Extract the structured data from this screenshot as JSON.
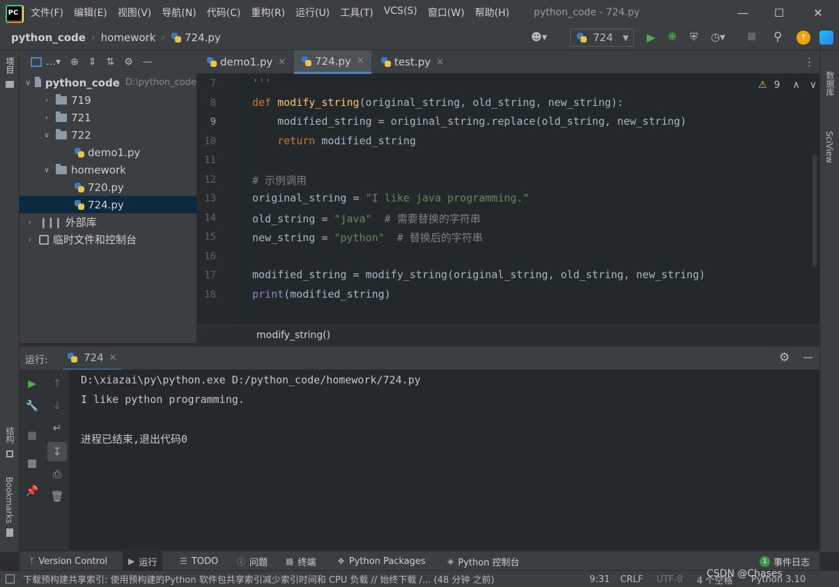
{
  "app": {
    "menu": [
      "文件(F)",
      "编辑(E)",
      "视图(V)",
      "导航(N)",
      "代码(C)",
      "重构(R)",
      "运行(U)",
      "工具(T)",
      "VCS(S)",
      "窗口(W)",
      "帮助(H)"
    ],
    "window_title": "python_code - 724.py"
  },
  "nav": {
    "crumbs": [
      "python_code",
      "homework",
      "724.py"
    ],
    "run_config": "724"
  },
  "left_strip": {
    "project": "项目",
    "structure": "结构",
    "bookmarks": "Bookmarks"
  },
  "right_strip": {
    "database": "数据库",
    "sciview": "SciView"
  },
  "project": {
    "root": "python_code",
    "root_path": "D:\\python_code",
    "items": [
      "719",
      "721",
      "722",
      "demo1.py",
      "homework",
      "720.py",
      "724.py",
      "外部库",
      "临时文件和控制台"
    ]
  },
  "tabs": [
    "demo1.py",
    "724.py",
    "test.py"
  ],
  "editor": {
    "line_numbers": [
      "7",
      "8",
      "9",
      "10",
      "11",
      "12",
      "13",
      "14",
      "15",
      "16",
      "17",
      "18"
    ],
    "warnings": "9",
    "breadcrumb": "modify_string()",
    "line7": "'''",
    "line8": {
      "kw": "def ",
      "fn": "modify_string",
      "args": "(original_string, old_string, new_string):"
    },
    "line9": "    modified_string = original_string.replace(old_string, new_string)",
    "line10": {
      "kw": "    return ",
      "rest": "modified_string"
    },
    "line12": "# 示例调用",
    "line13": {
      "var": "original_string = ",
      "str": "\"I like java programming.\""
    },
    "line14": {
      "var": "old_string = ",
      "str": "\"java\"",
      "cm": "  # 需要替换的字符串"
    },
    "line15": {
      "var": "new_string = ",
      "str": "\"python\"",
      "cm": "  # 替换后的字符串"
    },
    "line17": "modified_string = modify_string(original_string, old_string, new_string)",
    "line18": {
      "bi": "print",
      "rest": "(modified_string)"
    }
  },
  "run": {
    "label": "运行:",
    "tab": "724",
    "output": [
      "D:\\xiazai\\py\\python.exe D:/python_code/homework/724.py",
      "I like python programming.",
      "",
      "进程已结束,退出代码0"
    ]
  },
  "bottom_tabs": [
    "Version Control",
    "运行",
    "TODO",
    "问题",
    "终端",
    "Python Packages",
    "Python 控制台",
    "事件日志"
  ],
  "event_count": "1",
  "status": {
    "message": "下载预构建共享索引: 使用预构建的Python 软件包共享索引减少索引时间和 CPU 负载 // 始终下载 /... (48 分钟 之前)",
    "position": "9:31",
    "line_sep": "CRLF",
    "encoding": "UTF-8",
    "indent": "4 个空格",
    "interpreter": "Python 3.10",
    "watermark": "CSDN @Chases"
  }
}
